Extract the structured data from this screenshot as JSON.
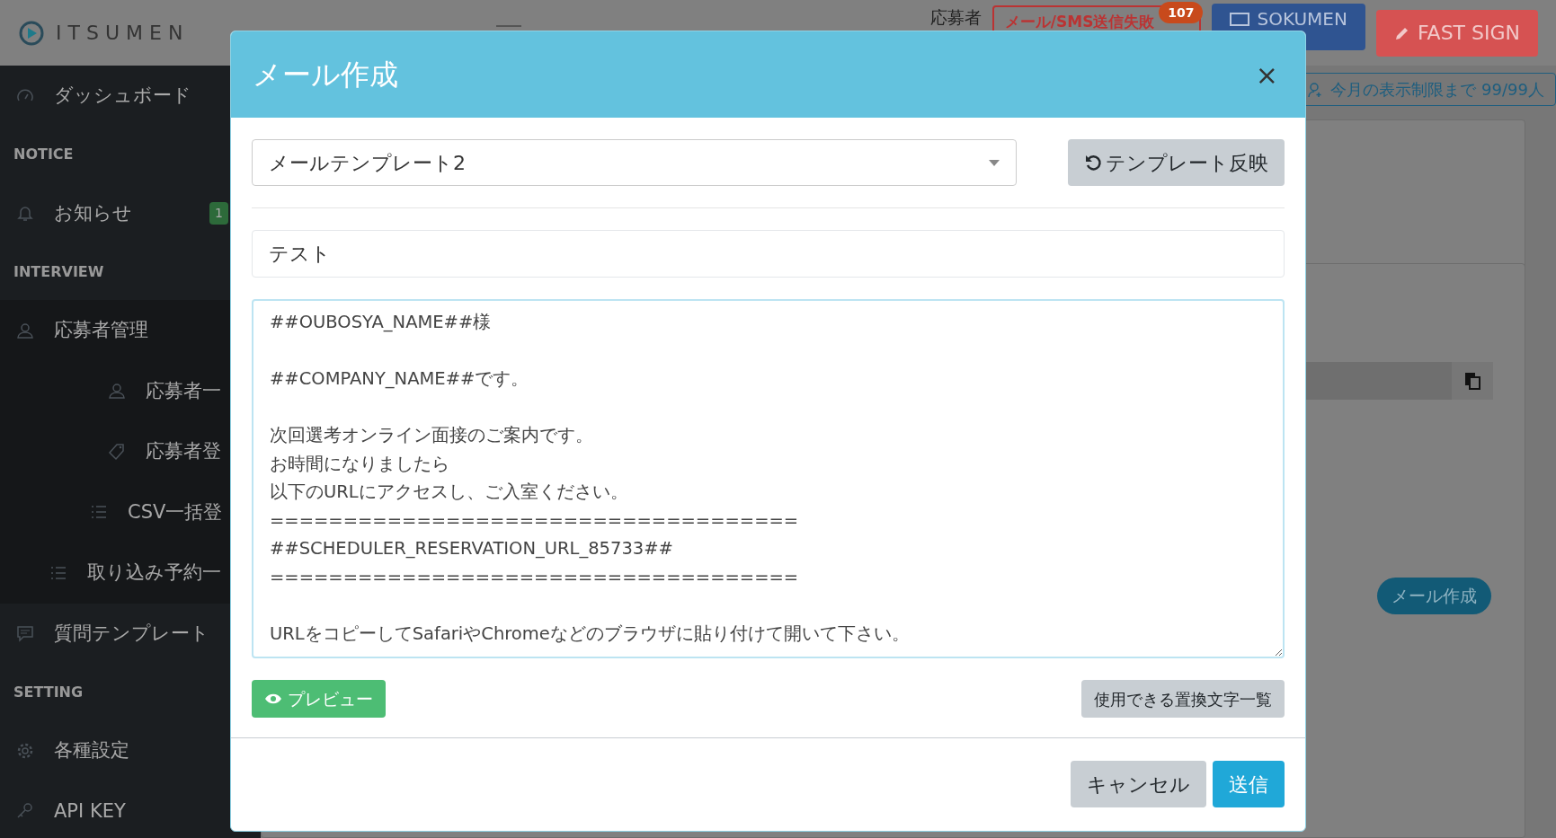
{
  "header": {
    "logo": "ITSUMEN",
    "user_label": "応募者",
    "alert_button": "メール/SMS送信失敗",
    "alert_badge": "107",
    "sokumen_button": "SOKUMEN",
    "fast_sign_button": "FAST SIGN"
  },
  "sidebar": {
    "items": [
      {
        "kind": "item",
        "label": "ダッシュボード"
      },
      {
        "kind": "heading",
        "label": "NOTICE"
      },
      {
        "kind": "item",
        "label": "お知らせ",
        "badge": "1"
      },
      {
        "kind": "heading",
        "label": "INTERVIEW"
      },
      {
        "kind": "item",
        "label": "応募者管理",
        "children": [
          {
            "kind": "item",
            "label": "応募者一"
          },
          {
            "kind": "item",
            "label": "応募者登"
          },
          {
            "kind": "item",
            "label": "CSV一括登"
          },
          {
            "kind": "item",
            "label": "取り込み予約一"
          }
        ]
      },
      {
        "kind": "item",
        "label": "質問テンプレート"
      },
      {
        "kind": "heading",
        "label": "SETTING"
      },
      {
        "kind": "item",
        "label": "各種設定"
      },
      {
        "kind": "item",
        "label": "API KEY"
      }
    ]
  },
  "main": {
    "limit_button": "今月の表示制限まで 99/99人",
    "mail_button": "メール作成"
  },
  "modal": {
    "title": "メール作成",
    "close": "×",
    "template_select": "メールテンプレート2",
    "reflect_button": "テンプレート反映",
    "subject": "テスト",
    "body_paragraphs": [
      {
        "lines": [
          "##OUBOSYA_NAME##様"
        ]
      },
      {
        "lines": [
          "##COMPANY_NAME##です。"
        ]
      },
      {
        "lines": [
          "次回選考オンライン面接のご案内です。",
          "お時間になりましたら",
          "以下のURLにアクセスし、ご入室ください。",
          "====================================",
          "##SCHEDULER_RESERVATION_URL_85733##",
          "===================================="
        ]
      },
      {
        "lines": [
          "URLをコピーしてSafariやChromeなどのブラウザに貼り付けて開いて下さい。"
        ]
      }
    ],
    "preview_button": "プレビュー",
    "variables_button": "使用できる置換文字一覧",
    "cancel_button": "キャンセル",
    "send_button": "送信"
  }
}
